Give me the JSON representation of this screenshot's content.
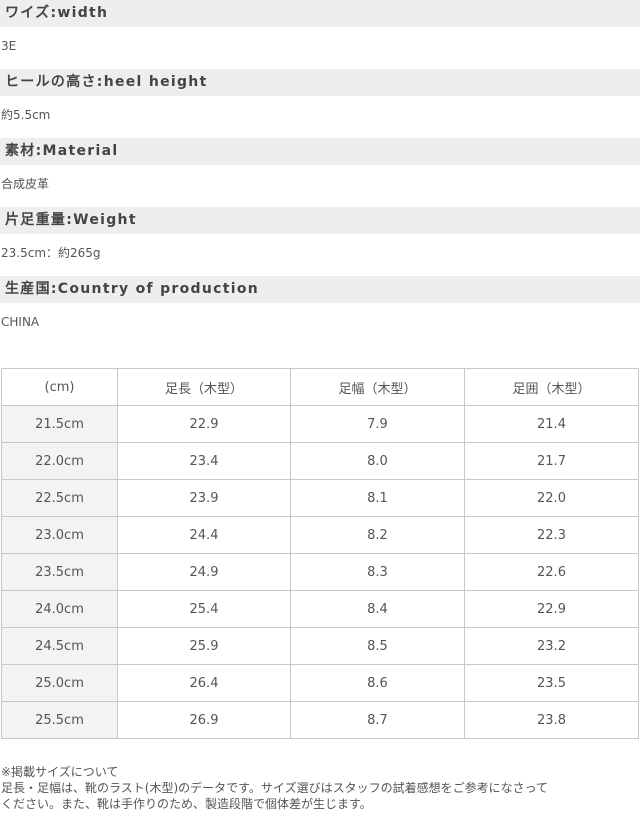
{
  "specs": [
    {
      "label": "ワイズ:width",
      "value": "3E"
    },
    {
      "label": "ヒールの高さ:heel height",
      "value": "約5.5cm"
    },
    {
      "label": "素材:Material",
      "value": "合成皮革"
    },
    {
      "label": "片足重量:Weight",
      "value": "23.5cm：約265g"
    },
    {
      "label": "生産国:Country of production",
      "value": "CHINA"
    }
  ],
  "size_table": {
    "headers": [
      "(cm)",
      "足長（木型）",
      "足幅（木型）",
      "足囲（木型）"
    ],
    "rows": [
      [
        "21.5cm",
        "22.9",
        "7.9",
        "21.4"
      ],
      [
        "22.0cm",
        "23.4",
        "8.0",
        "21.7"
      ],
      [
        "22.5cm",
        "23.9",
        "8.1",
        "22.0"
      ],
      [
        "23.0cm",
        "24.4",
        "8.2",
        "22.3"
      ],
      [
        "23.5cm",
        "24.9",
        "8.3",
        "22.6"
      ],
      [
        "24.0cm",
        "25.4",
        "8.4",
        "22.9"
      ],
      [
        "24.5cm",
        "25.9",
        "8.5",
        "23.2"
      ],
      [
        "25.0cm",
        "26.4",
        "8.6",
        "23.5"
      ],
      [
        "25.5cm",
        "26.9",
        "8.7",
        "23.8"
      ]
    ]
  },
  "note": {
    "line1": "※掲載サイズについて",
    "line2": "足長・足幅は、靴のラスト(木型)のデータです。サイズ選びはスタッフの試着感想をご参考になさって",
    "line3": "ください。また、靴は手作りのため、製造段階で個体差が生じます。"
  }
}
